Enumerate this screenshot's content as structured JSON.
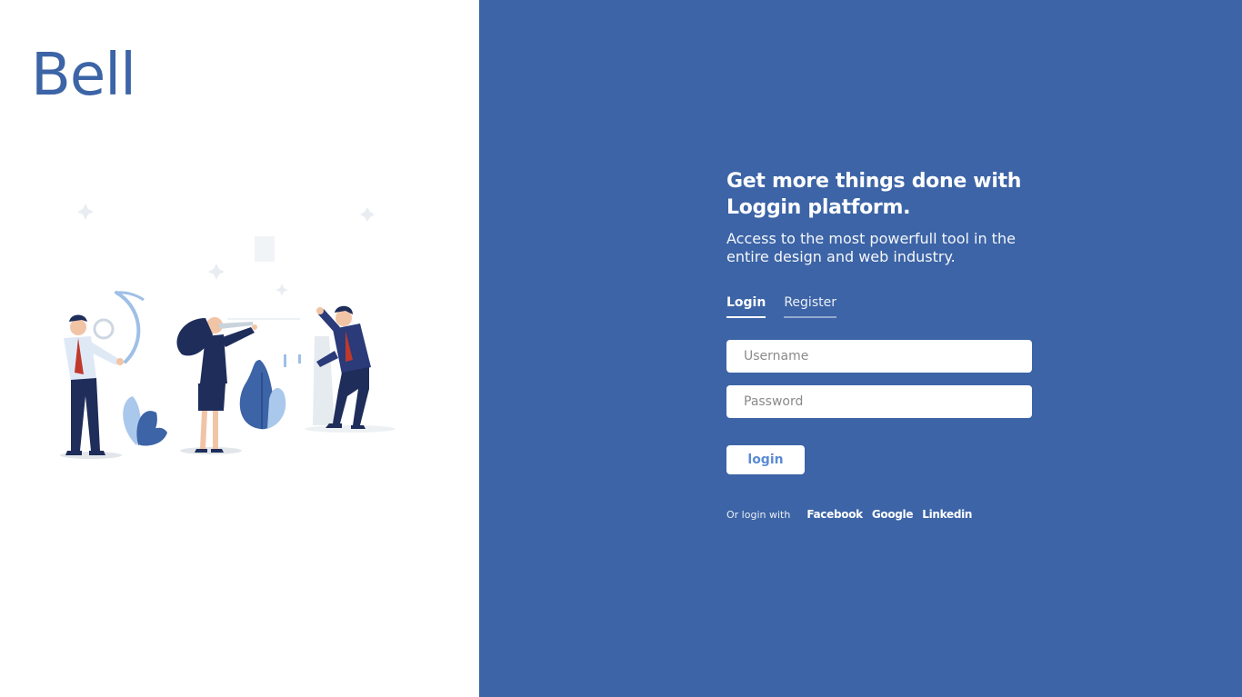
{
  "colors": {
    "brand_blue": "#3c64a6",
    "panel_blue": "#3c64a6",
    "button_text": "#5b8bd4",
    "white": "#ffffff"
  },
  "brand": {
    "logo_text": "Bell"
  },
  "illustration": {
    "icon": "team-collaboration-illustration"
  },
  "hero": {
    "headline_line1": "Get more things done with",
    "headline_line2": "Loggin platform.",
    "subheadline_line1": "Access to the most powerfull tool in the",
    "subheadline_line2": "entire design and web industry."
  },
  "tabs": [
    {
      "label": "Login",
      "active": true
    },
    {
      "label": "Register",
      "active": false
    }
  ],
  "form": {
    "username_placeholder": "Username",
    "username_value": "",
    "password_placeholder": "Password",
    "password_value": "",
    "submit_label": "login"
  },
  "social": {
    "label": "Or login with",
    "providers": [
      "Facebook",
      "Google",
      "Linkedin"
    ]
  }
}
